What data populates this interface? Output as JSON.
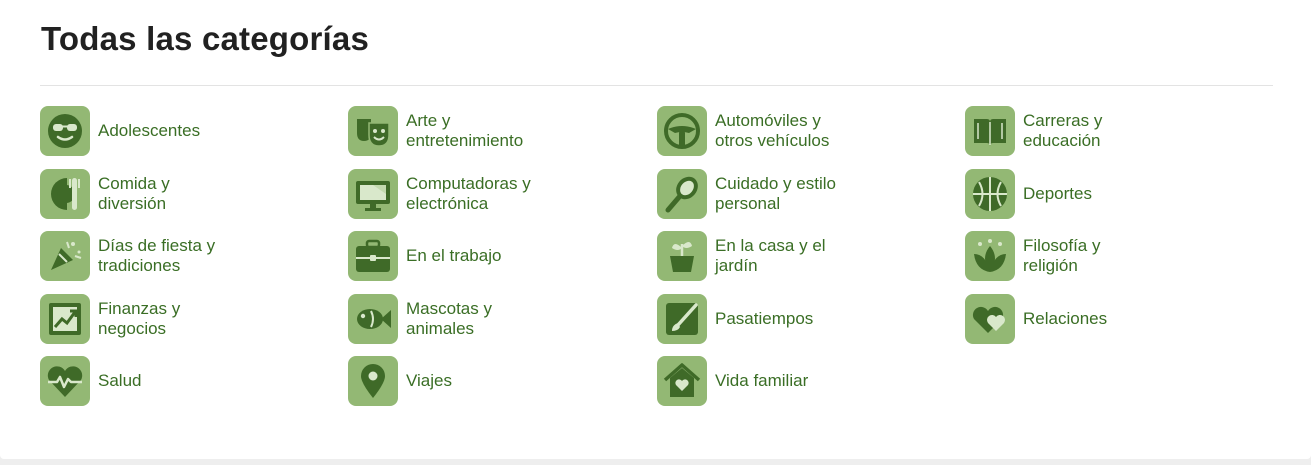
{
  "page": {
    "title": "Todas las categorías"
  },
  "colors": {
    "icon_bg": "#93b874",
    "icon_fg": "#3f6a28",
    "label": "#3a6e25",
    "title": "#212121"
  },
  "categories": [
    {
      "label": "Adolescentes",
      "icon": "sunglasses-face-icon"
    },
    {
      "label": "Arte y\nentretenimiento",
      "icon": "theater-masks-icon"
    },
    {
      "label": "Automóviles y\notros vehículos",
      "icon": "steering-wheel-icon"
    },
    {
      "label": "Carreras y\neducación",
      "icon": "open-book-icon"
    },
    {
      "label": "Comida y\ndiversión",
      "icon": "plate-fork-icon"
    },
    {
      "label": "Computadoras y\nelectrónica",
      "icon": "monitor-icon"
    },
    {
      "label": "Cuidado y estilo\npersonal",
      "icon": "hairbrush-icon"
    },
    {
      "label": "Deportes",
      "icon": "basketball-icon"
    },
    {
      "label": "Días de fiesta y\ntradiciones",
      "icon": "party-popper-icon"
    },
    {
      "label": "En el trabajo",
      "icon": "briefcase-icon"
    },
    {
      "label": "En la casa y el\njardín",
      "icon": "potted-plant-icon"
    },
    {
      "label": "Filosofía y\nreligión",
      "icon": "lotus-icon"
    },
    {
      "label": "Finanzas y\nnegocios",
      "icon": "line-chart-icon"
    },
    {
      "label": "Mascotas y\nanimales",
      "icon": "fish-icon"
    },
    {
      "label": "Pasatiempos",
      "icon": "paintbrush-canvas-icon"
    },
    {
      "label": "Relaciones",
      "icon": "two-hearts-icon"
    },
    {
      "label": "Salud",
      "icon": "heartbeat-icon"
    },
    {
      "label": "Viajes",
      "icon": "map-pin-icon"
    },
    {
      "label": "Vida familiar",
      "icon": "house-heart-icon"
    }
  ]
}
